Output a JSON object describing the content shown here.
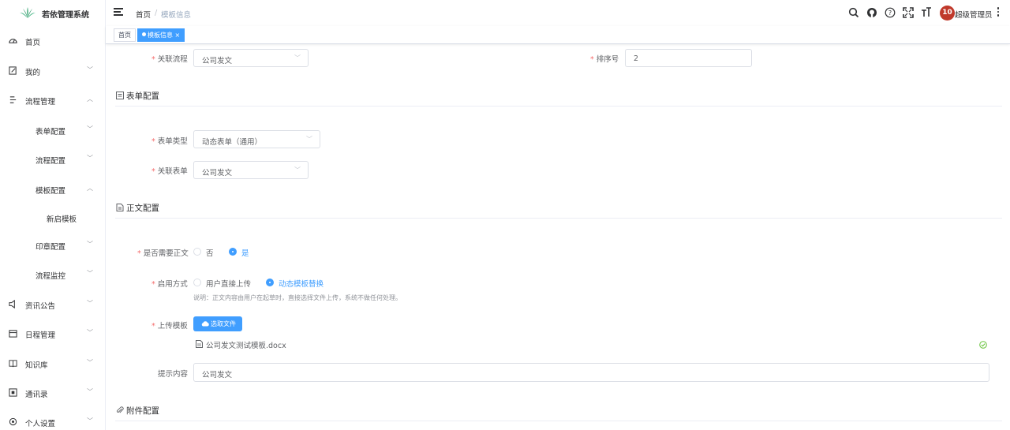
{
  "app": {
    "title": "若依管理系统"
  },
  "sidebar": {
    "items": [
      {
        "label": "首页",
        "icon": "dashboard-icon"
      },
      {
        "label": "我的",
        "icon": "edit-icon"
      },
      {
        "label": "流程管理",
        "icon": "process-icon"
      },
      {
        "label": "表单配置"
      },
      {
        "label": "流程配置"
      },
      {
        "label": "模板配置"
      },
      {
        "label": "新启模板"
      },
      {
        "label": "印章配置"
      },
      {
        "label": "流程监控"
      },
      {
        "label": "资讯公告",
        "icon": "speaker-icon"
      },
      {
        "label": "日程管理",
        "icon": "calendar-icon"
      },
      {
        "label": "知识库",
        "icon": "book-icon"
      },
      {
        "label": "通讯录",
        "icon": "contacts-icon"
      },
      {
        "label": "个人设置",
        "icon": "settings-icon"
      }
    ]
  },
  "header": {
    "breadcrumb": {
      "home": "首页",
      "sep": "/",
      "current": "模板信息"
    },
    "avatar_text": "10",
    "user_name": "超级管理员"
  },
  "tags": {
    "home": "首页",
    "active": "模板信息 ×"
  },
  "form": {
    "flow_label": "关联流程",
    "flow_value": "公司发文",
    "sort_label": "排序号",
    "sort_value": "2",
    "section_form_title": "表单配置",
    "form_type_label": "表单类型",
    "form_type_value": "动态表单（通用）",
    "linked_form_label": "关联表单",
    "linked_form_value": "公司发文",
    "section_body_title": "正文配置",
    "need_body_label": "是否需要正文",
    "need_body_no": "否",
    "need_body_yes": "是",
    "mode_label": "启用方式",
    "mode_upload": "用户直接上传",
    "mode_template": "动态模板替换",
    "mode_hint": "说明：正文内容由用户在起草时，直接选择文件上传，系统不做任何处理。",
    "upload_label": "上传模板",
    "upload_button": "选取文件",
    "file_name": "公司发文测试模板.docx",
    "tip_label": "提示内容",
    "tip_value": "公司发文",
    "section_attach_title": "附件配置"
  },
  "colors": {
    "primary": "#409eff",
    "required": "#f56c6c",
    "avatar": "#c0392b"
  }
}
